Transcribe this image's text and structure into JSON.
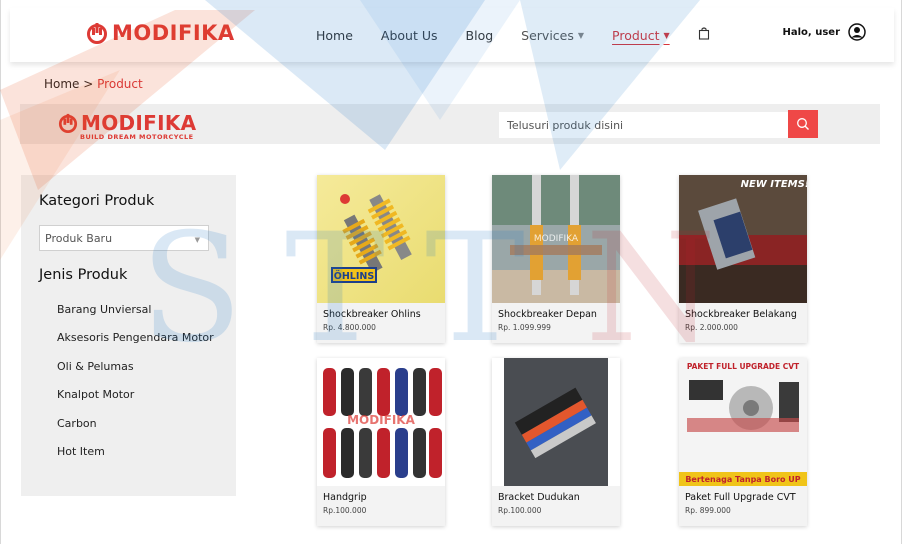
{
  "nav": {
    "brand": "MODIFIKA",
    "items": [
      {
        "label": "Home"
      },
      {
        "label": "About Us"
      },
      {
        "label": "Blog"
      },
      {
        "label": "Services"
      },
      {
        "label": "Product"
      }
    ],
    "user_greeting": "Halo, user"
  },
  "breadcrumb": {
    "home": "Home",
    "separator": ">",
    "current": "Product"
  },
  "search_band": {
    "logo_text": "MODIFIKA",
    "logo_tagline": "BUILD DREAM MOTORCYCLE",
    "placeholder": "Telusuri produk disini"
  },
  "sidebar": {
    "category_title": "Kategori Produk",
    "category_select": "Produk Baru",
    "type_title": "Jenis Produk",
    "types": [
      "Barang Unviersal",
      "Aksesoris Pengendara Motor",
      "Oli & Pelumas",
      "Knalpot Motor",
      "Carbon",
      "Hot Item"
    ]
  },
  "products": [
    {
      "name": "Shockbreaker Ohlins",
      "price": "Rp. 4.800.000",
      "image_label": "ÖHLINS"
    },
    {
      "name": "Shockbreaker Depan",
      "price": "Rp. 1.099.999",
      "image_label": "MODIFIKA"
    },
    {
      "name": "Shockbreaker Belakang",
      "price": "Rp. 2.000.000",
      "image_label": "NEW ITEMS!"
    },
    {
      "name": "Handgrip",
      "price": "Rp.100.000",
      "image_label": "MODIFIKA"
    },
    {
      "name": "Bracket Dudukan",
      "price": "Rp.100.000",
      "image_label": ""
    },
    {
      "name": "Paket Full Upgrade CVT",
      "price": "Rp. 899.000",
      "image_label": "PAKET FULL UPGRADE CVT",
      "image_caption": "Bertenaga Tanpa Boro UP"
    }
  ],
  "colors": {
    "accent": "#dd3a35",
    "search_button": "#ef4847",
    "band": "#eeeeee",
    "sidebar": "#efefef"
  }
}
